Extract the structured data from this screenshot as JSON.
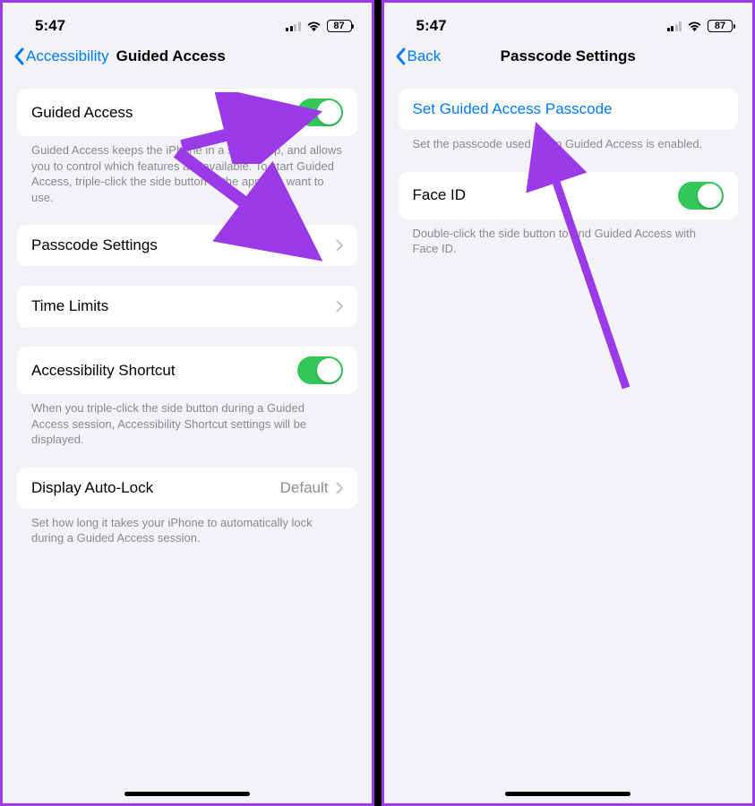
{
  "left": {
    "status": {
      "time": "5:47",
      "battery": "87"
    },
    "nav": {
      "back_label": "Accessibility",
      "title": "Guided Access"
    },
    "sections": {
      "guided_access": {
        "label": "Guided Access",
        "footer": "Guided Access keeps the iPhone in a single app, and allows you to control which features are available. To start Guided Access, triple-click the side button in the app you want to use."
      },
      "passcode": {
        "label": "Passcode Settings"
      },
      "time_limits": {
        "label": "Time Limits"
      },
      "shortcut": {
        "label": "Accessibility Shortcut",
        "footer": "When you triple-click the side button during a Guided Access session, Accessibility Shortcut settings will be displayed."
      },
      "autolock": {
        "label": "Display Auto-Lock",
        "value": "Default",
        "footer": "Set how long it takes your iPhone to automatically lock during a Guided Access session."
      }
    }
  },
  "right": {
    "status": {
      "time": "5:47",
      "battery": "87"
    },
    "nav": {
      "back_label": "Back",
      "title": "Passcode Settings"
    },
    "sections": {
      "set_passcode": {
        "label": "Set Guided Access Passcode",
        "footer": "Set the passcode used when Guided Access is enabled."
      },
      "faceid": {
        "label": "Face ID",
        "footer": "Double-click the side button to end Guided Access with Face ID."
      }
    }
  }
}
